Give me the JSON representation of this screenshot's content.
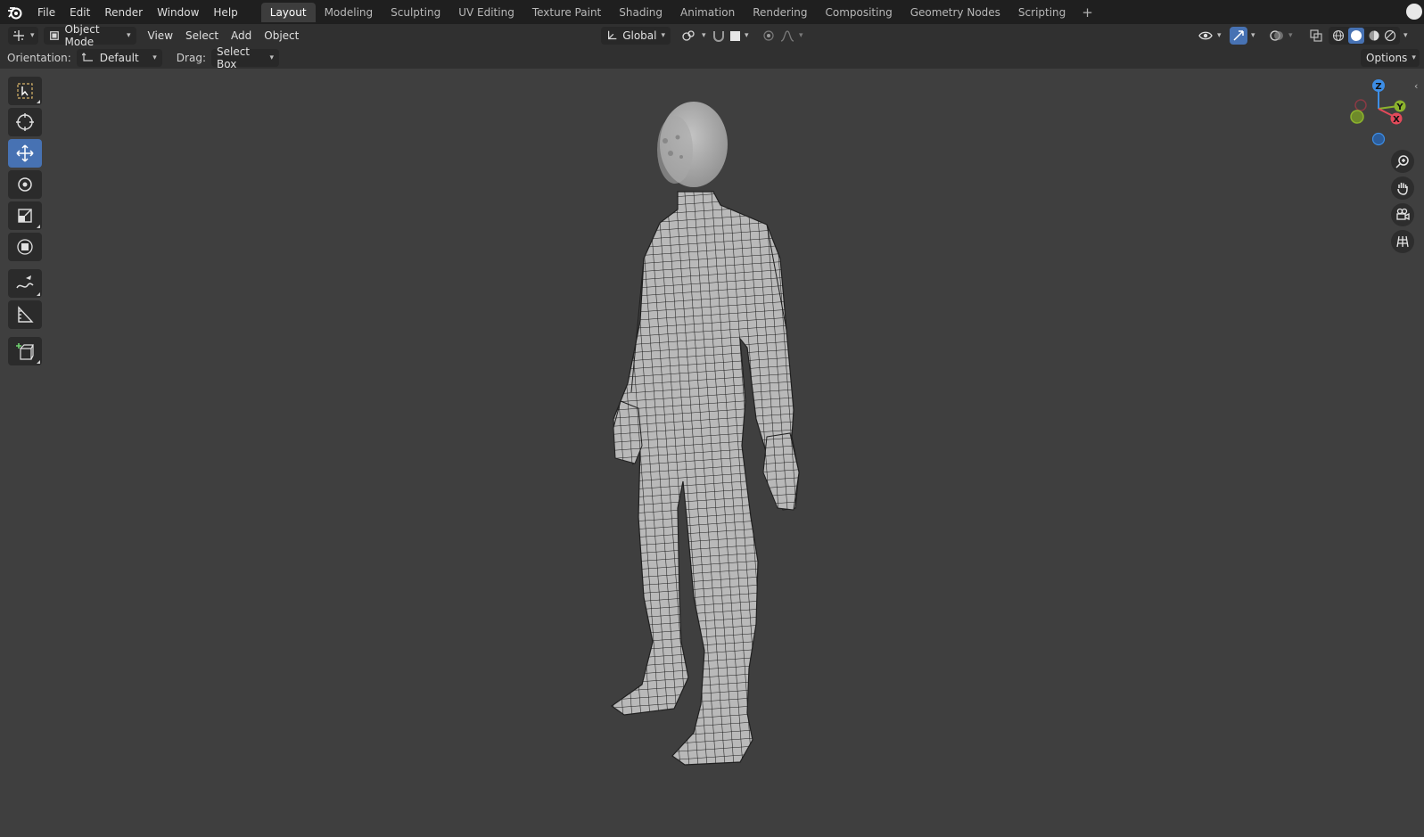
{
  "menubar": {
    "logo": "blender-logo-icon",
    "items": [
      "File",
      "Edit",
      "Render",
      "Window",
      "Help"
    ]
  },
  "workspace_tabs": [
    {
      "label": "Layout",
      "active": true
    },
    {
      "label": "Modeling",
      "active": false
    },
    {
      "label": "Sculpting",
      "active": false
    },
    {
      "label": "UV Editing",
      "active": false
    },
    {
      "label": "Texture Paint",
      "active": false
    },
    {
      "label": "Shading",
      "active": false
    },
    {
      "label": "Animation",
      "active": false
    },
    {
      "label": "Rendering",
      "active": false
    },
    {
      "label": "Compositing",
      "active": false
    },
    {
      "label": "Geometry Nodes",
      "active": false
    },
    {
      "label": "Scripting",
      "active": false
    }
  ],
  "header": {
    "mode": "Object Mode",
    "menus": [
      "View",
      "Select",
      "Add",
      "Object"
    ],
    "transform_orientation": "Global"
  },
  "tool_settings": {
    "orientation_label": "Orientation:",
    "orientation_value": "Default",
    "drag_label": "Drag:",
    "drag_value": "Select Box",
    "options_label": "Options"
  },
  "toolbar": [
    {
      "name": "select-box-tool",
      "icon": "select-box-icon",
      "active": false
    },
    {
      "name": "cursor-tool",
      "icon": "cursor-icon",
      "active": false
    },
    {
      "name": "move-tool",
      "icon": "move-icon",
      "active": true
    },
    {
      "name": "rotate-tool",
      "icon": "rotate-icon",
      "active": false
    },
    {
      "name": "scale-tool",
      "icon": "scale-icon",
      "active": false
    },
    {
      "name": "transform-tool",
      "icon": "transform-icon",
      "active": false
    },
    {
      "name": "annotate-tool",
      "icon": "annotate-icon",
      "active": false
    },
    {
      "name": "measure-tool",
      "icon": "measure-icon",
      "active": false
    },
    {
      "name": "add-cube-tool",
      "icon": "add-cube-icon",
      "active": false
    }
  ],
  "gizmo": {
    "axes": [
      "Z",
      "Y",
      "X"
    ],
    "colors": {
      "x": "#e34a5a",
      "y": "#8cb32d",
      "z": "#3d8ee6"
    }
  },
  "nav_buttons": [
    "zoom-icon",
    "hand-icon",
    "camera-icon",
    "grid-icon"
  ],
  "colors": {
    "accent": "#4772b3",
    "viewport_bg": "#3f3f3f"
  }
}
